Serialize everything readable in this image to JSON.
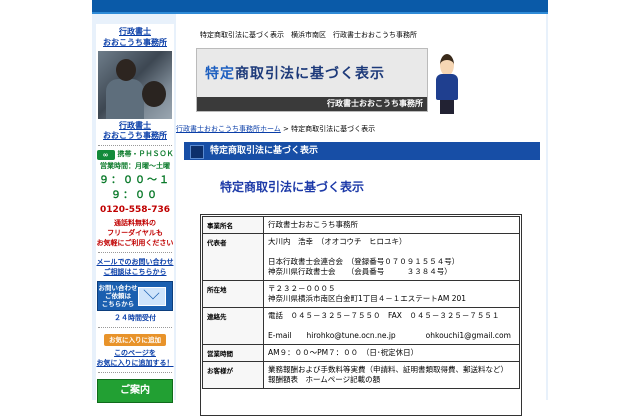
{
  "sidebar": {
    "office_name_1": "行政書士",
    "office_name_2": "おおこうち事務所",
    "office_link": "行政書士\nおおこうち事務所",
    "mobile_label": "携帯・ＰＨＳＯＫ",
    "hours_label": "営業時間：月曜～土曜",
    "hours": "９：００～１９：００",
    "phone": "0120-558-736",
    "free_1": "通話料無料の",
    "free_2": "フリーダイヤルも",
    "free_3": "お気軽にご利用ください",
    "mail_link_1": "メールでのお問い合わせ",
    "mail_link_2": "ご相談はこちらから",
    "mail_btn_1": "お問い合わせ",
    "mail_btn_2": "ご依頼は",
    "mail_btn_3": "こちらから",
    "mail_24h": "２４時間受付",
    "fav_btn": "お気に入りに追加",
    "fav_text_1": "このページを",
    "fav_text_2": "お気に入りに追加する！",
    "guide_btn": "ご案内"
  },
  "main": {
    "page_header": "特定商取引法に基づく表示　横浜市南区　行政書士おおこうち事務所",
    "banner_title_accent": "特定",
    "banner_title_rest": "商取引法に基づく表示",
    "banner_sub": "行政書士おおこうち事務所",
    "breadcrumb_home": "行政書士おおこうち事務所ホーム",
    "breadcrumb_sep": " > ",
    "breadcrumb_current": "特定商取引法に基づく表示",
    "section_title": "特定商取引法に基づく表示",
    "page_title": "特定商取引法に基づく表示"
  },
  "table": {
    "rows": [
      {
        "label": "事業所名",
        "lines": [
          "行政書士おおこうち事務所"
        ]
      },
      {
        "label": "代表者",
        "lines": [
          "大川内　浩幸　（オオコウチ　ヒロユキ）",
          "",
          "日本行政書士会連合会　（登録番号０７０９１５５４号）",
          "神奈川県行政書士会　　（会員番号　　　３３８４号）"
        ]
      },
      {
        "label": "所在地",
        "lines": [
          "〒２３２－０００５",
          "神奈川県横浜市南区白金町1丁目４－１エステートAM 201"
        ]
      },
      {
        "label": "連絡先",
        "lines": [
          "電話　０４５－３２５－７５５０　FAX　０４５－３２５－７５５１",
          "",
          "E-mail　　hirohko@tune.ocn.ne.jp　　　　ohkouchi1@gmail.com"
        ]
      },
      {
        "label": "営業時間",
        "lines": [
          "AM９：００～PM７：００　（日･祝定休日）"
        ]
      },
      {
        "label": "お客様が",
        "lines": [
          "業務報酬および手数料等実費（申請料、証明書類取得費、郵送料など）",
          "報酬額表　ホームページ記載の額"
        ]
      }
    ]
  }
}
